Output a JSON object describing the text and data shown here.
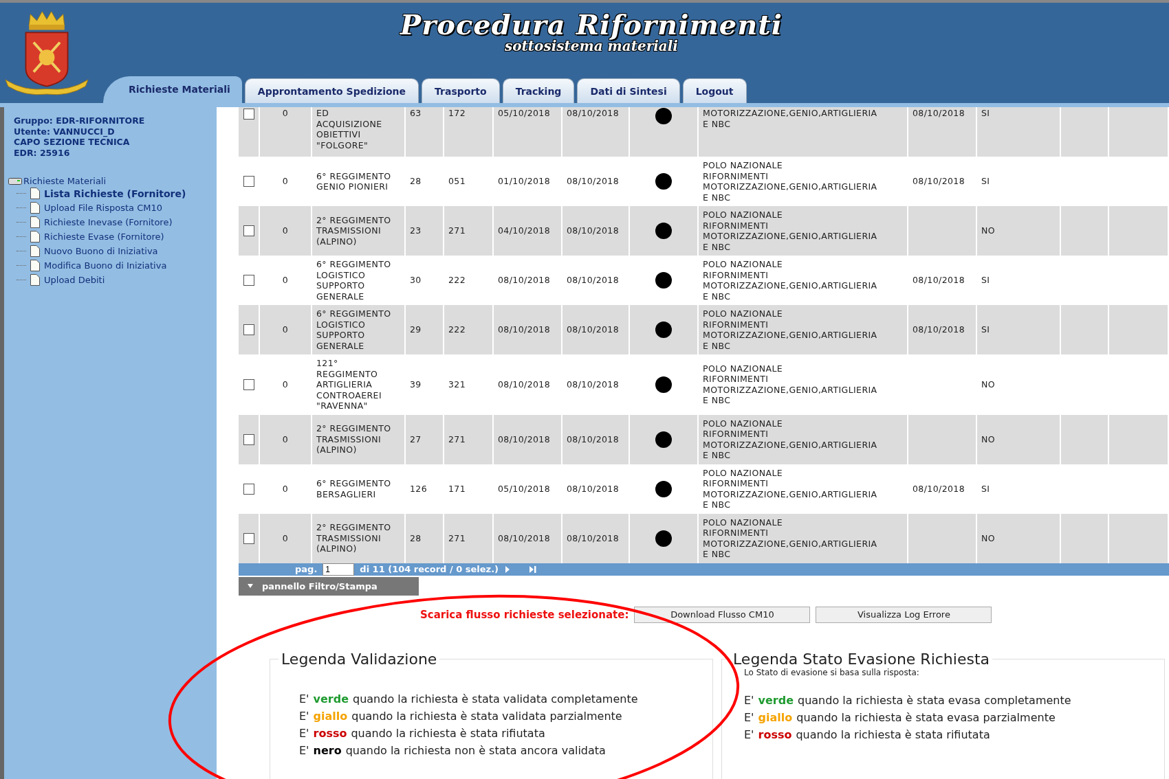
{
  "header": {
    "title": "Procedura Rifornimenti",
    "subtitle": "sottosistema materiali"
  },
  "tabs": [
    {
      "label": "Richieste Materiali",
      "selected": true
    },
    {
      "label": "Approntamento Spedizione",
      "selected": false
    },
    {
      "label": "Trasporto",
      "selected": false
    },
    {
      "label": "Tracking",
      "selected": false
    },
    {
      "label": "Dati di Sintesi",
      "selected": false
    },
    {
      "label": "Logout",
      "selected": false
    }
  ],
  "user_info": [
    "Gruppo: EDR-RIFORNITORE",
    "Utente: VANNUCCI_D",
    "CAPO SEZIONE TECNICA",
    "EDR: 25916"
  ],
  "tree": {
    "label": "Richieste Materiali",
    "expanded": true,
    "children": [
      {
        "label": "Lista Richieste (Fornitore)",
        "selected": true
      },
      {
        "label": "Upload File Risposta CM10",
        "selected": false
      },
      {
        "label": "Richieste Inevase (Fornitore)",
        "selected": false
      },
      {
        "label": "Richieste Evase (Fornitore)",
        "selected": false
      },
      {
        "label": "Nuovo Buono di Iniziativa",
        "selected": false
      },
      {
        "label": "Modifica Buono di Iniziativa",
        "selected": false
      },
      {
        "label": "Upload Debiti",
        "selected": false
      }
    ]
  },
  "table": {
    "rows": [
      {
        "checked": false,
        "column_2": "0",
        "column_3": "ED\nACQUISIZIONE\nOBIETTIVI\n\"FOLGORE\"",
        "column_4": "63",
        "column_5": "172",
        "column_6": "05/10/2018",
        "column_7": "08/10/2018",
        "color": "#000000",
        "column_9": "MOTORIZZAZIONE,GENIO,ARTIGLIERIA\nE NBC",
        "column_10": "08/10/2018",
        "column_11": "SI"
      },
      {
        "checked": false,
        "column_2": "0",
        "column_3": "6° REGGIMENTO\nGENIO PIONIERI",
        "column_4": "28",
        "column_5": "051",
        "column_6": "01/10/2018",
        "column_7": "08/10/2018",
        "color": "#000000",
        "column_9": "POLO NAZIONALE\nRIFORNIMENTI\nMOTORIZZAZIONE,GENIO,ARTIGLIERIA\nE NBC",
        "column_10": "08/10/2018",
        "column_11": "SI"
      },
      {
        "checked": false,
        "column_2": "0",
        "column_3": "2° REGGIMENTO\nTRASMISSIONI\n(ALPINO)",
        "column_4": "23",
        "column_5": "271",
        "column_6": "04/10/2018",
        "column_7": "08/10/2018",
        "color": "#000000",
        "column_9": "POLO NAZIONALE\nRIFORNIMENTI\nMOTORIZZAZIONE,GENIO,ARTIGLIERIA\nE NBC",
        "column_11": "NO"
      },
      {
        "checked": false,
        "column_2": "0",
        "column_3": "6° REGGIMENTO\nLOGISTICO\nSUPPORTO\nGENERALE",
        "column_4": "30",
        "column_5": "222",
        "column_6": "08/10/2018",
        "column_7": "08/10/2018",
        "color": "#000000",
        "column_9": "POLO NAZIONALE\nRIFORNIMENTI\nMOTORIZZAZIONE,GENIO,ARTIGLIERIA\nE NBC",
        "column_10": "08/10/2018",
        "column_11": "SI"
      },
      {
        "checked": false,
        "column_2": "0",
        "column_3": "6° REGGIMENTO\nLOGISTICO\nSUPPORTO\nGENERALE",
        "column_4": "29",
        "column_5": "222",
        "column_6": "08/10/2018",
        "column_7": "08/10/2018",
        "color": "#000000",
        "column_9": "POLO NAZIONALE\nRIFORNIMENTI\nMOTORIZZAZIONE,GENIO,ARTIGLIERIA\nE NBC",
        "column_10": "08/10/2018",
        "column_11": "SI"
      },
      {
        "checked": false,
        "column_2": "0",
        "column_3": "121°\nREGGIMENTO\nARTIGLIERIA\nCONTROAEREI\n\"RAVENNA\"",
        "column_4": "39",
        "column_5": "321",
        "column_6": "08/10/2018",
        "column_7": "08/10/2018",
        "color": "#000000",
        "column_9": "POLO NAZIONALE\nRIFORNIMENTI\nMOTORIZZAZIONE,GENIO,ARTIGLIERIA\nE NBC",
        "column_11": "NO"
      },
      {
        "checked": false,
        "column_2": "0",
        "column_3": "2° REGGIMENTO\nTRASMISSIONI\n(ALPINO)",
        "column_4": "27",
        "column_5": "271",
        "column_6": "08/10/2018",
        "column_7": "08/10/2018",
        "color": "#000000",
        "column_9": "POLO NAZIONALE\nRIFORNIMENTI\nMOTORIZZAZIONE,GENIO,ARTIGLIERIA\nE NBC",
        "column_11": "NO"
      },
      {
        "checked": false,
        "column_2": "0",
        "column_3": "6° REGGIMENTO\nBERSAGLIERI",
        "column_4": "126",
        "column_5": "171",
        "column_6": "05/10/2018",
        "column_7": "08/10/2018",
        "color": "#000000",
        "column_9": "POLO NAZIONALE\nRIFORNIMENTI\nMOTORIZZAZIONE,GENIO,ARTIGLIERIA\nE NBC",
        "column_10": "08/10/2018",
        "column_11": "SI"
      },
      {
        "checked": false,
        "column_2": "0",
        "column_3": "2° REGGIMENTO\nTRASMISSIONI\n(ALPINO)",
        "column_4": "28",
        "column_5": "271",
        "column_6": "08/10/2018",
        "column_7": "08/10/2018",
        "color": "#000000",
        "column_9": "POLO NAZIONALE\nRIFORNIMENTI\nMOTORIZZAZIONE,GENIO,ARTIGLIERIA\nE NBC",
        "column_11": "NO"
      }
    ]
  },
  "pager": {
    "label": "pag.",
    "value": "1",
    "summary": "di 11 (104 record / 0 selez.)"
  },
  "filter_panel": {
    "label": "pannello Filtro/Stampa",
    "expanded": false
  },
  "download": {
    "label": "Scarica flusso richieste selezionate:",
    "buttons": [
      "Download Flusso CM10",
      "Visualizza Log Errore"
    ]
  },
  "legends": [
    {
      "title": "Legenda Validazione",
      "items": [
        {
          "prefix": "E'",
          "word": "verde",
          "color": "#1f9b30",
          "rest": "quando la richiesta è stata validata completamente"
        },
        {
          "prefix": "E'",
          "word": "giallo",
          "color": "#f5a300",
          "rest": "quando la richiesta è stata validata parzialmente"
        },
        {
          "prefix": "E'",
          "word": "rosso",
          "color": "#cc0000",
          "rest": "quando la richiesta è stata rifiutata"
        },
        {
          "prefix": "E'",
          "word": "nero",
          "color": "#000000",
          "rest": "quando la richiesta non è stata ancora validata"
        }
      ]
    },
    {
      "title": "Legenda Stato Evasione Richiesta",
      "note": "Lo Stato di evasione si basa sulla risposta:",
      "items": [
        {
          "prefix": "E'",
          "word": "verde",
          "color": "#1f9b30",
          "rest": "quando la richiesta è stata evasa completamente"
        },
        {
          "prefix": "E'",
          "word": "giallo",
          "color": "#f5a300",
          "rest": "quando la richiesta è stata evasa parzialmente"
        },
        {
          "prefix": "E'",
          "word": "rosso",
          "color": "#cc0000",
          "rest": "quando la richiesta è stata rifiutata"
        }
      ]
    }
  ]
}
